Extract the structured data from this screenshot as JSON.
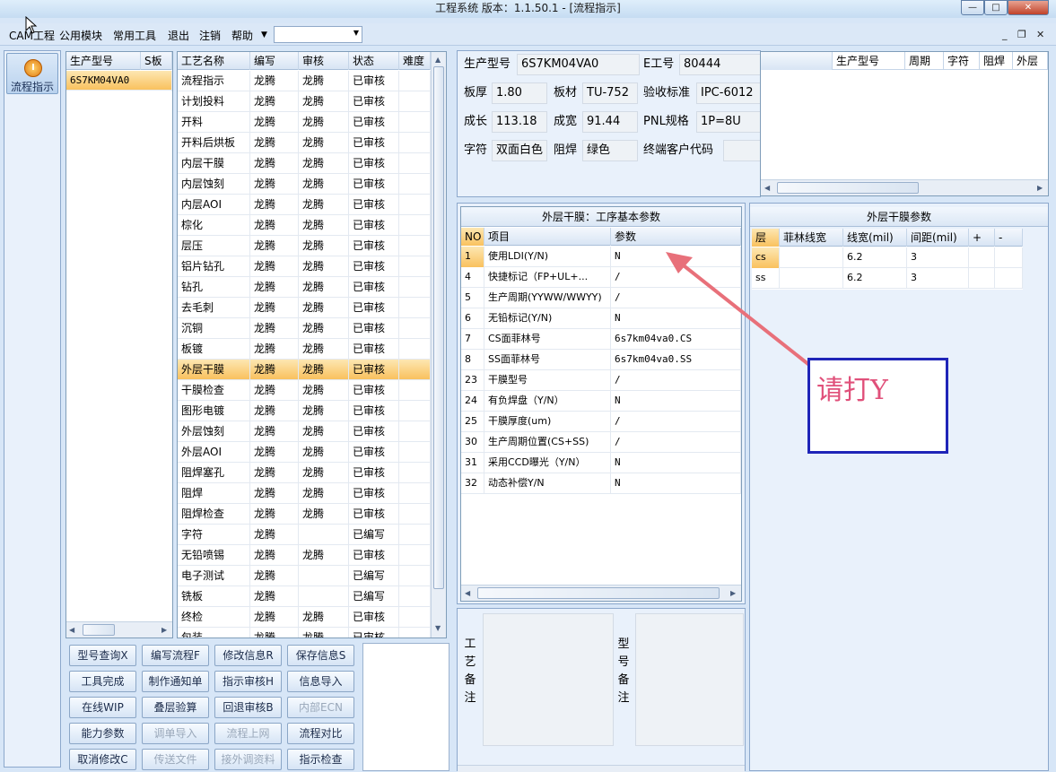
{
  "title": "工程系统    版本：1.1.50.1 - [流程指示]",
  "menu": [
    "CAM工程",
    "公用模块",
    "常用工具",
    "退出",
    "注销",
    "帮助"
  ],
  "sidebar": {
    "label": "流程指示"
  },
  "model_grid": {
    "headers": [
      "生产型号",
      "S板"
    ],
    "rows": [
      [
        "6S7KM04VA0",
        ""
      ]
    ]
  },
  "process_grid": {
    "headers": [
      "工艺名称",
      "编写",
      "审核",
      "状态",
      "难度"
    ],
    "rows": [
      [
        "流程指示",
        "龙腾",
        "龙腾",
        "已审核",
        ""
      ],
      [
        "计划投料",
        "龙腾",
        "龙腾",
        "已审核",
        ""
      ],
      [
        "开料",
        "龙腾",
        "龙腾",
        "已审核",
        ""
      ],
      [
        "开料后烘板",
        "龙腾",
        "龙腾",
        "已审核",
        ""
      ],
      [
        "内层干膜",
        "龙腾",
        "龙腾",
        "已审核",
        ""
      ],
      [
        "内层蚀刻",
        "龙腾",
        "龙腾",
        "已审核",
        ""
      ],
      [
        "内层AOI",
        "龙腾",
        "龙腾",
        "已审核",
        ""
      ],
      [
        "棕化",
        "龙腾",
        "龙腾",
        "已审核",
        ""
      ],
      [
        "层压",
        "龙腾",
        "龙腾",
        "已审核",
        ""
      ],
      [
        "铝片钻孔",
        "龙腾",
        "龙腾",
        "已审核",
        ""
      ],
      [
        "钻孔",
        "龙腾",
        "龙腾",
        "已审核",
        ""
      ],
      [
        "去毛刺",
        "龙腾",
        "龙腾",
        "已审核",
        ""
      ],
      [
        "沉铜",
        "龙腾",
        "龙腾",
        "已审核",
        ""
      ],
      [
        "板镀",
        "龙腾",
        "龙腾",
        "已审核",
        ""
      ],
      [
        "外层干膜",
        "龙腾",
        "龙腾",
        "已审核",
        ""
      ],
      [
        "干膜检查",
        "龙腾",
        "龙腾",
        "已审核",
        ""
      ],
      [
        "图形电镀",
        "龙腾",
        "龙腾",
        "已审核",
        ""
      ],
      [
        "外层蚀刻",
        "龙腾",
        "龙腾",
        "已审核",
        ""
      ],
      [
        "外层AOI",
        "龙腾",
        "龙腾",
        "已审核",
        ""
      ],
      [
        "阻焊塞孔",
        "龙腾",
        "龙腾",
        "已审核",
        ""
      ],
      [
        "阻焊",
        "龙腾",
        "龙腾",
        "已审核",
        ""
      ],
      [
        "阻焊检查",
        "龙腾",
        "龙腾",
        "已审核",
        ""
      ],
      [
        "字符",
        "龙腾",
        "",
        "已编写",
        ""
      ],
      [
        "无铅喷锡",
        "龙腾",
        "龙腾",
        "已审核",
        ""
      ],
      [
        "电子测试",
        "龙腾",
        "",
        "已编写",
        ""
      ],
      [
        "铣板",
        "龙腾",
        "",
        "已编写",
        ""
      ],
      [
        "终检",
        "龙腾",
        "龙腾",
        "已审核",
        ""
      ],
      [
        "包装",
        "龙腾",
        "龙腾",
        "已审核",
        ""
      ]
    ]
  },
  "buttons": [
    [
      "型号查询X",
      "编写流程F",
      "修改信息R",
      "保存信息S"
    ],
    [
      "工具完成",
      "制作通知单",
      "指示审核H",
      "信息导入"
    ],
    [
      "在线WIP",
      "叠层验算",
      "回退审核B",
      "内部ECN"
    ],
    [
      "能力参数",
      "调单导入",
      "流程上网",
      "流程对比"
    ],
    [
      "取消修改C",
      "传送文件",
      "接外调资料",
      "指示检查"
    ]
  ],
  "info": {
    "model_label": "生产型号",
    "model_value": "6S7KM04VA0",
    "e_label": "E工号",
    "e_value": "80444",
    "thick_label": "板厚",
    "thick_value": "1.80",
    "material_label": "板材",
    "material_value": "TU-752",
    "std_label": "验收标准",
    "std_value": "IPC-6012",
    "len_label": "成长",
    "len_value": "113.18",
    "wid_label": "成宽",
    "wid_value": "91.44",
    "pnl_label": "PNL规格",
    "pnl_value": "1P=8U",
    "char_label": "字符",
    "char_value": "双面白色",
    "mask_label": "阻焊",
    "mask_value": "绿色",
    "cust_label": "终端客户代码",
    "cust_value": ""
  },
  "history_grid": {
    "headers": [
      "生产型号",
      "周期",
      "字符",
      "阻焊",
      "外层"
    ]
  },
  "params": {
    "title": "外层干膜：工序基本参数",
    "headers": [
      "NO",
      "项目",
      "参数"
    ],
    "rows": [
      [
        "1",
        "使用LDI(Y/N)",
        "N"
      ],
      [
        "4",
        "快捷标记（FP+UL+...",
        "/"
      ],
      [
        "5",
        "生产周期(YYWW/WWYY)",
        "/"
      ],
      [
        "6",
        "无铅标记(Y/N)",
        "N"
      ],
      [
        "7",
        "CS面菲林号",
        "6s7km04va0.CS"
      ],
      [
        "8",
        "SS面菲林号",
        "6s7km04va0.SS"
      ],
      [
        "23",
        "干膜型号",
        "/"
      ],
      [
        "24",
        "有负焊盘（Y/N）",
        "N"
      ],
      [
        "25",
        "干膜厚度(um)",
        "/"
      ],
      [
        "30",
        "生产周期位置(CS+SS)",
        "/"
      ],
      [
        "31",
        "采用CCD曝光（Y/N）",
        "N"
      ],
      [
        "32",
        "动态补偿Y/N",
        "N"
      ]
    ]
  },
  "film": {
    "title": "外层干膜参数",
    "headers": [
      "层",
      "菲林线宽",
      "线宽(mil)",
      "间距(mil)",
      "+",
      "-"
    ],
    "rows": [
      [
        "cs",
        "",
        "6.2",
        "3",
        "",
        ""
      ],
      [
        "ss",
        "",
        "6.2",
        "3",
        "",
        ""
      ]
    ]
  },
  "annotation": {
    "text": "请打Y",
    "color": "#e0507a"
  },
  "remarks": {
    "process_label": "工艺备注",
    "model_label": "型号备注"
  }
}
